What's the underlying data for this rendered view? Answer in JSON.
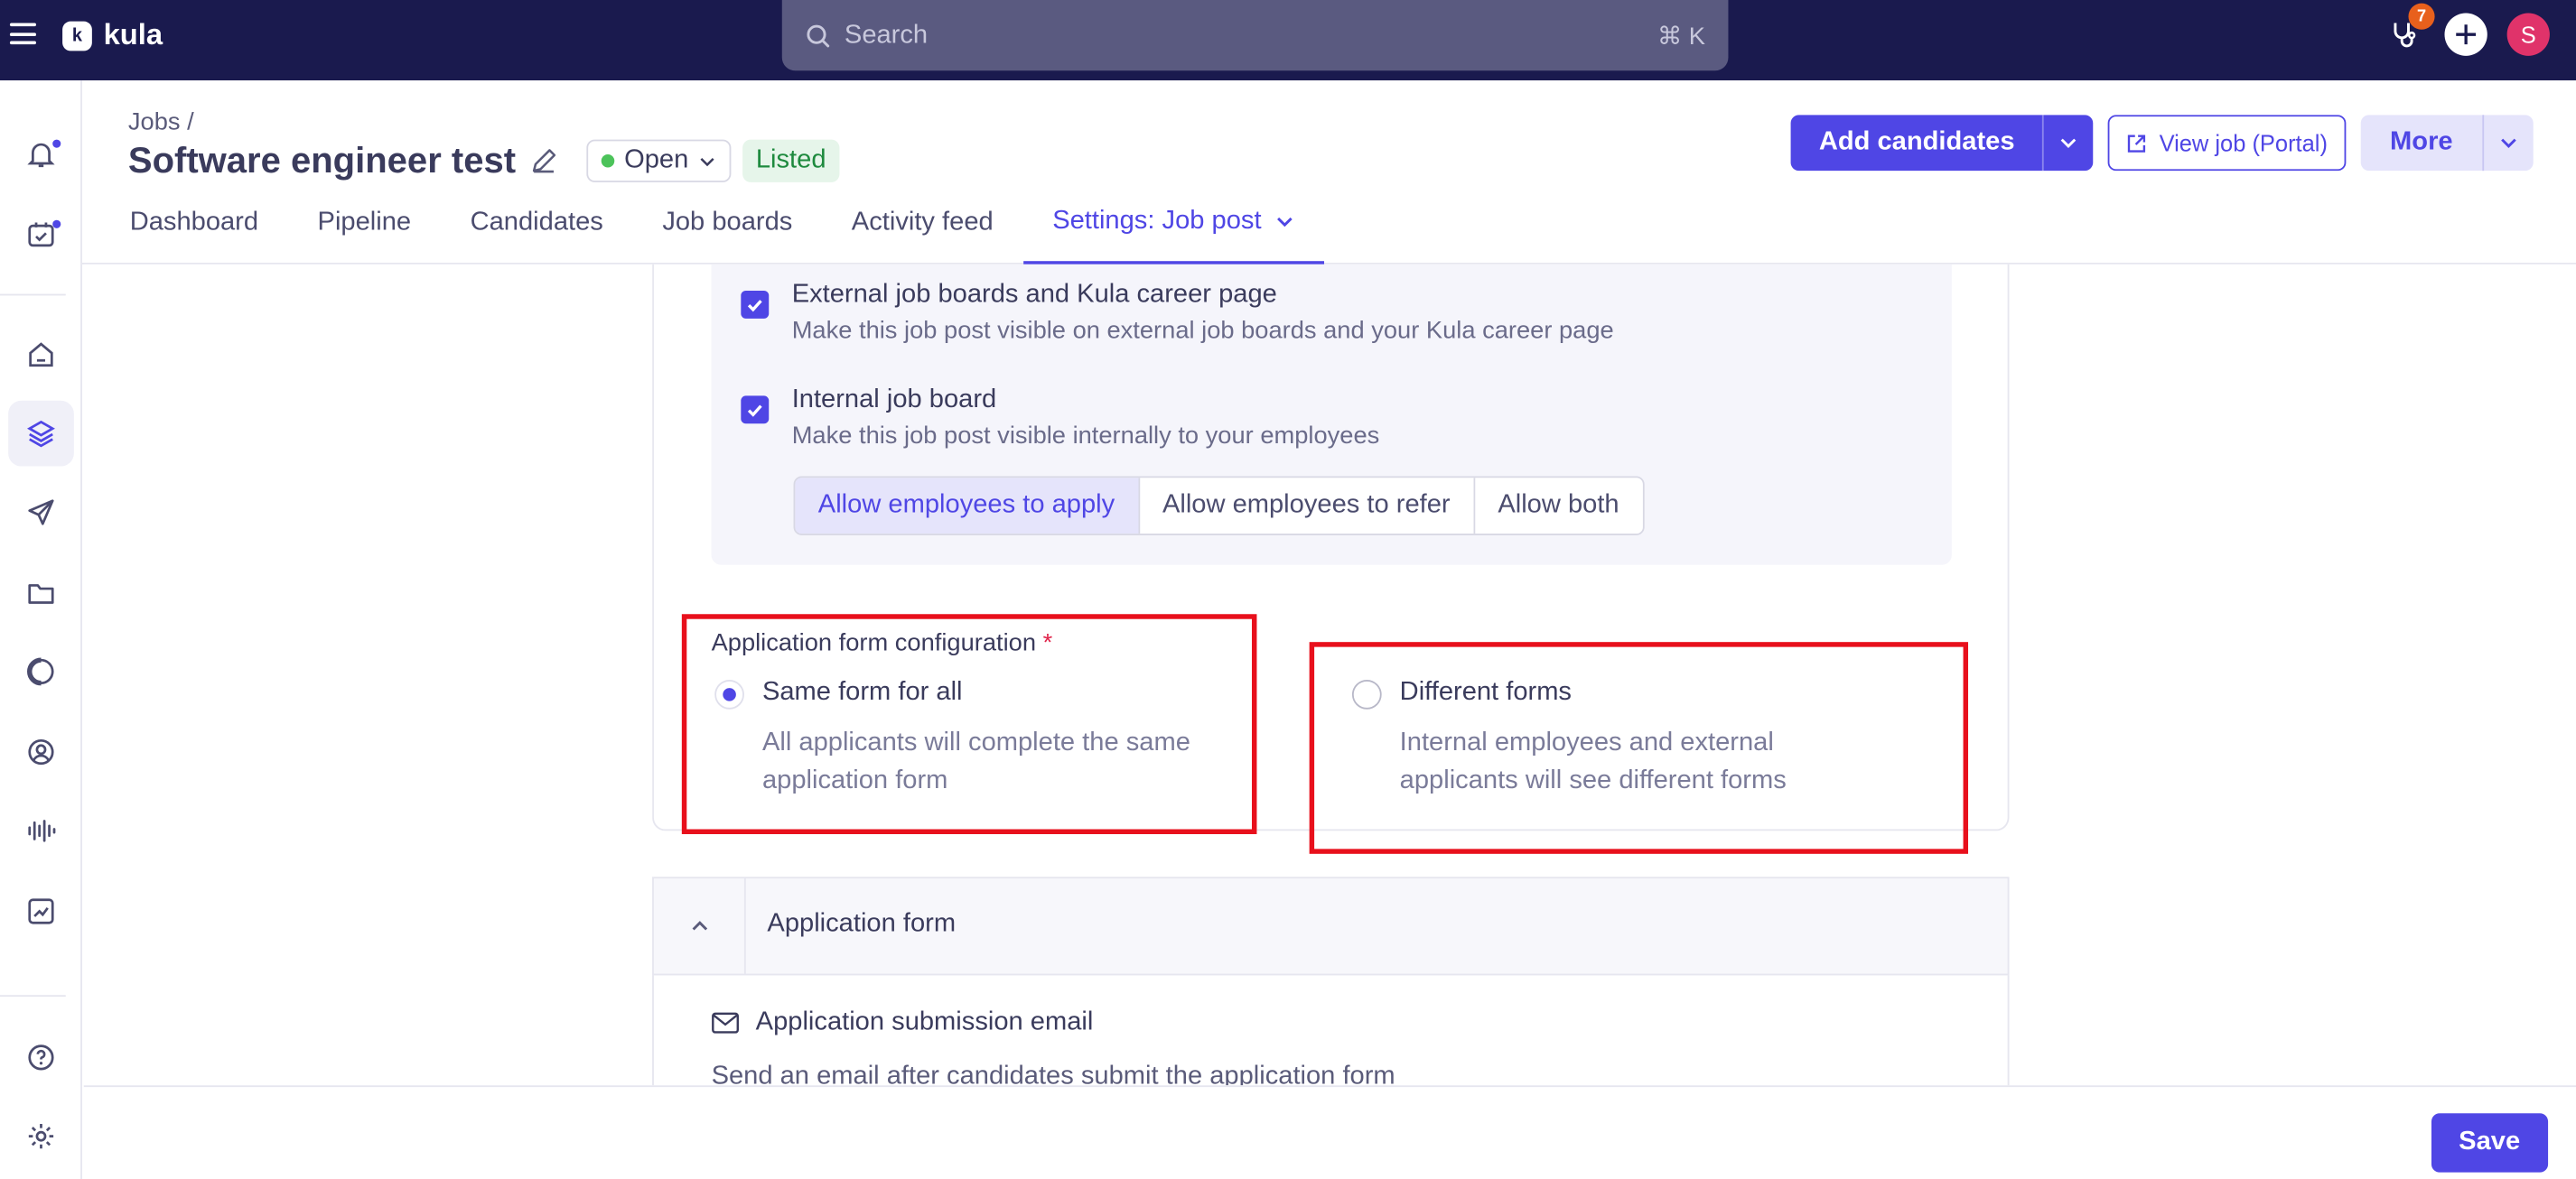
{
  "app": {
    "name": "kula",
    "logo_letter": "k"
  },
  "search": {
    "placeholder": "Search",
    "shortcut": "⌘ K"
  },
  "topbar": {
    "notification_count": "7",
    "avatar_initial": "S"
  },
  "colors": {
    "brand": "#4f46e5",
    "topbar": "#1a1a4e",
    "highlight": "#e8101c",
    "status_open": "#4cc35a"
  },
  "header": {
    "breadcrumb": "Jobs /",
    "title": "Software engineer test",
    "status": "Open",
    "listed": "Listed",
    "add_candidates": "Add candidates",
    "view_job": "View job (Portal)",
    "more": "More"
  },
  "tabs": [
    "Dashboard",
    "Pipeline",
    "Candidates",
    "Job boards",
    "Activity feed",
    "Settings: Job post"
  ],
  "visibility": {
    "external": {
      "title": "External job boards and Kula career page",
      "desc": "Make this job post visible on external job boards and your Kula career page",
      "checked": true
    },
    "internal": {
      "title": "Internal job board",
      "desc": "Make this job post visible internally to your employees",
      "checked": true
    },
    "options": [
      "Allow employees to apply",
      "Allow employees to refer",
      "Allow both"
    ],
    "selected_option": "Allow employees to apply"
  },
  "form_config": {
    "label": "Application form configuration",
    "required_mark": "*",
    "same": {
      "title": "Same form for all",
      "desc": "All applicants will complete the same application form",
      "selected": true
    },
    "different": {
      "title": "Different forms",
      "desc": "Internal employees and external applicants will see different forms",
      "selected": false
    }
  },
  "application_form": {
    "title": "Application form",
    "email_title": "Application submission email",
    "email_desc": "Send an email after candidates submit the application form"
  },
  "footer": {
    "save": "Save"
  }
}
